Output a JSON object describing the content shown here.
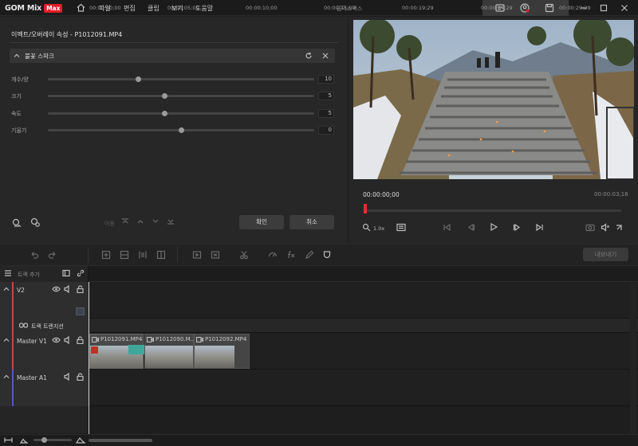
{
  "app": {
    "logo_text": "GOM Mix",
    "logo_badge": "Max",
    "window_title": "곰믹스맥스",
    "menu": [
      "파일",
      "편집",
      "클립",
      "보기",
      "도움말"
    ]
  },
  "effect_panel": {
    "title": "이펙트/오버레이 속성 - P1012091.MP4",
    "effect_name": "불꽃 스파크",
    "params": [
      {
        "label": "개수/양",
        "value": "10",
        "level": 0.34
      },
      {
        "label": "크기",
        "value": "5",
        "level": 0.44
      },
      {
        "label": "속도",
        "value": "5",
        "level": 0.44
      },
      {
        "label": "기울기",
        "value": "0",
        "level": 0.5
      }
    ],
    "nav_label": "이동",
    "ok_label": "확인",
    "cancel_label": "취소"
  },
  "preview": {
    "current_time": "00:00:00;00",
    "total_time": "00:00:03;16",
    "zoom": "1.0x",
    "progress": 0.0
  },
  "toolbar": {
    "export_label": "내보내기"
  },
  "timeline": {
    "add_track_label": "트랙 추가",
    "ruler": [
      "00:00:00;00",
      "00:00:05;00",
      "00:00:10;00",
      "00:00:15;00",
      "00:00:19;29",
      "00:00:24;29",
      "00:00:29;29"
    ],
    "tracks": {
      "v2": "V2",
      "transition": "트랙 트랜지션",
      "master_v1": "Master V1",
      "master_a1": "Master A1"
    },
    "clips": [
      {
        "name": "P1012091.MP4"
      },
      {
        "name": "P1012090.M..."
      },
      {
        "name": "P1012092.MP4"
      }
    ]
  },
  "colors": {
    "accent_red": "#d9202a",
    "playhead": "#e03030",
    "transition_teal": "#3fa79a",
    "video_track_marker": "#c04848",
    "audio_track_marker": "#5858b8"
  }
}
